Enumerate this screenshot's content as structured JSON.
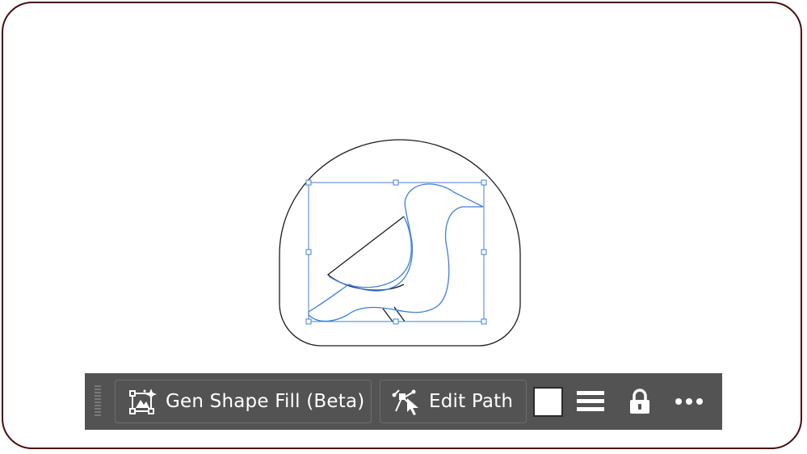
{
  "toolbar": {
    "gen_shape_fill_label": "Gen Shape Fill (Beta)",
    "edit_path_label": "Edit Path",
    "icons": {
      "grip": "drag-handle-icon",
      "gen_shape_fill": "gen-shape-fill-icon",
      "edit_path": "edit-path-icon",
      "fill_swatch": "fill-swatch",
      "stroke": "stroke-weight-icon",
      "lock": "lock-icon",
      "more": "more-options-icon"
    },
    "fill_color": "#ffffff"
  },
  "canvas": {
    "selection_color": "#3d7fd9",
    "outline_color": "#1a1a1a",
    "frame_border_color": "#4a0a0a"
  }
}
